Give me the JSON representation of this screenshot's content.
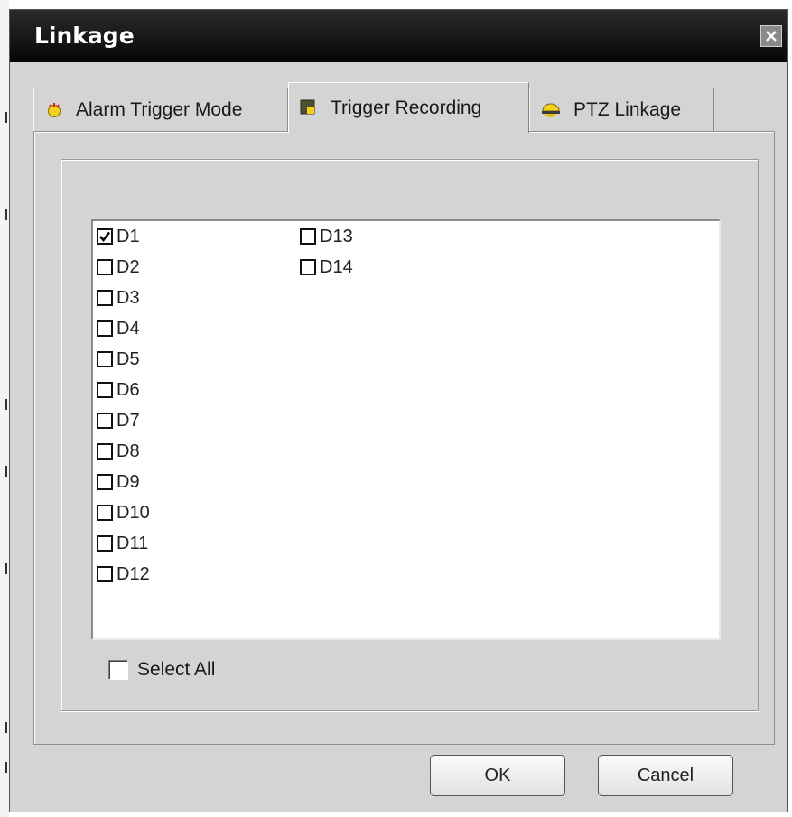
{
  "window": {
    "title": "Linkage",
    "close_icon": "close-icon"
  },
  "tabs": [
    {
      "label": "Alarm Trigger Mode",
      "icon": "hand-alarm-icon",
      "active": false
    },
    {
      "label": "Trigger Recording",
      "icon": "record-icon",
      "active": true
    },
    {
      "label": "PTZ Linkage",
      "icon": "ptz-dome-icon",
      "active": false
    }
  ],
  "channels": [
    {
      "label": "D1",
      "checked": true
    },
    {
      "label": "D2",
      "checked": false
    },
    {
      "label": "D3",
      "checked": false
    },
    {
      "label": "D4",
      "checked": false
    },
    {
      "label": "D5",
      "checked": false
    },
    {
      "label": "D6",
      "checked": false
    },
    {
      "label": "D7",
      "checked": false
    },
    {
      "label": "D8",
      "checked": false
    },
    {
      "label": "D9",
      "checked": false
    },
    {
      "label": "D10",
      "checked": false
    },
    {
      "label": "D11",
      "checked": false
    },
    {
      "label": "D12",
      "checked": false
    },
    {
      "label": "D13",
      "checked": false
    },
    {
      "label": "D14",
      "checked": false
    }
  ],
  "select_all": {
    "label": "Select All",
    "checked": false
  },
  "buttons": {
    "ok": "OK",
    "cancel": "Cancel"
  },
  "colors": {
    "titlebar": "#000000",
    "dialog_bg": "#d4d4d4",
    "tab_icon_yellow": "#f2d21a",
    "tab_icon_red": "#cc2222"
  }
}
